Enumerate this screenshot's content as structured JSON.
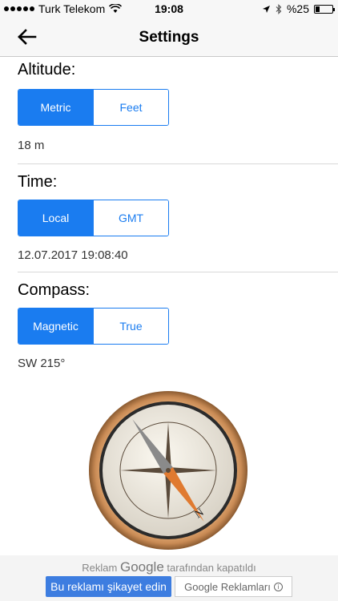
{
  "status_bar": {
    "carrier": "Turk Telekom",
    "time": "19:08",
    "battery": "%25",
    "battery_level": 0.25
  },
  "nav": {
    "title": "Settings"
  },
  "altitude": {
    "label": "Altitude:",
    "options": [
      "Metric",
      "Feet"
    ],
    "selected": "Metric",
    "value": "18 m"
  },
  "time": {
    "label": "Time:",
    "options": [
      "Local",
      "GMT"
    ],
    "selected": "Local",
    "value": "12.07.2017 19:08:40"
  },
  "compass": {
    "label": "Compass:",
    "options": [
      "Magnetic",
      "True"
    ],
    "selected": "Magnetic",
    "value": "SW 215°",
    "heading_deg": 215,
    "north_letter": "N"
  },
  "ad": {
    "prefix": "Reklam",
    "brand": "Google",
    "suffix": "tarafından kapatıldı",
    "report_button": "Bu reklamı şikayet edin",
    "google_ads_button": "Google Reklamları"
  },
  "colors": {
    "accent": "#1a7cf0",
    "compass_rim": "#c98b55"
  }
}
